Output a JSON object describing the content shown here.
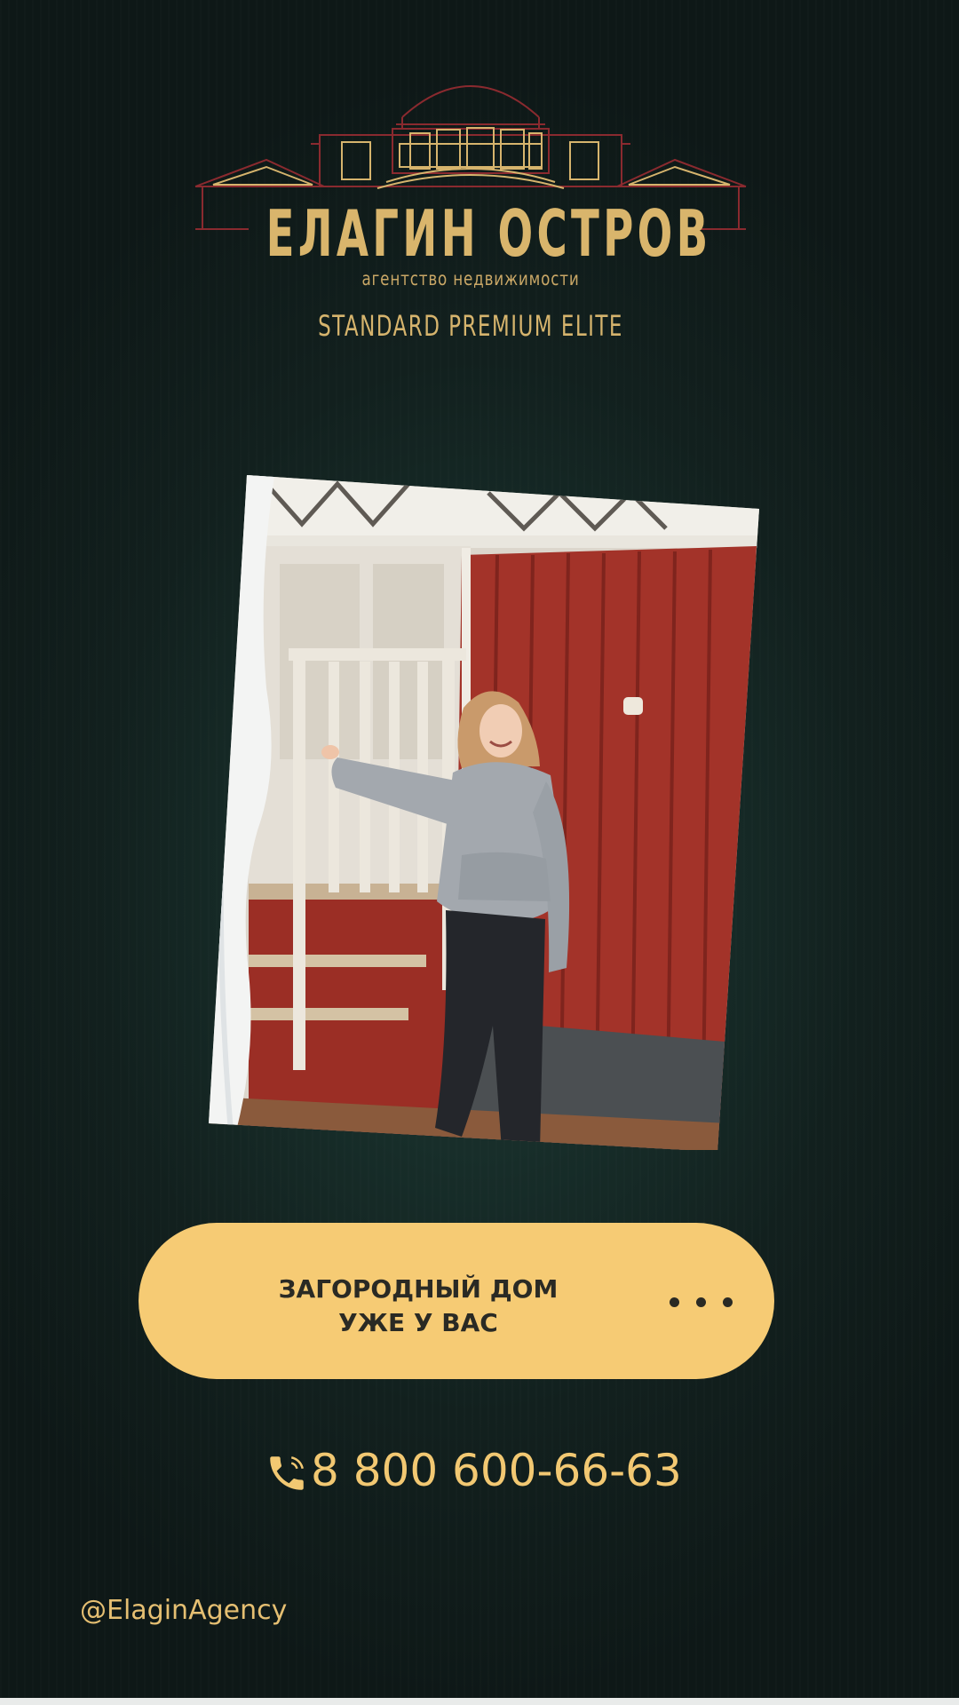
{
  "brand": {
    "name": "ЕЛАГИН ОСТРОВ",
    "subtitle": "агентство недвижимости",
    "tiers": "STANDARD  PREMIUM  ELITE",
    "colors": {
      "gold": "#d9b56c",
      "line_red": "#8a2a2f"
    }
  },
  "photo": {
    "icon": "photo-of-woman-at-red-house"
  },
  "cta": {
    "label": "ЗАГОРОДНЫЙ ДОМ УЖЕ У ВАС",
    "dots_icon": "more-dots-icon",
    "color": "#f6cb74"
  },
  "contact": {
    "phone_icon": "phone-icon",
    "phone": "8 800 600-66-63",
    "handle": "@ElaginAgency",
    "color": "#f2c872"
  },
  "background": {
    "color": "#14241f"
  }
}
